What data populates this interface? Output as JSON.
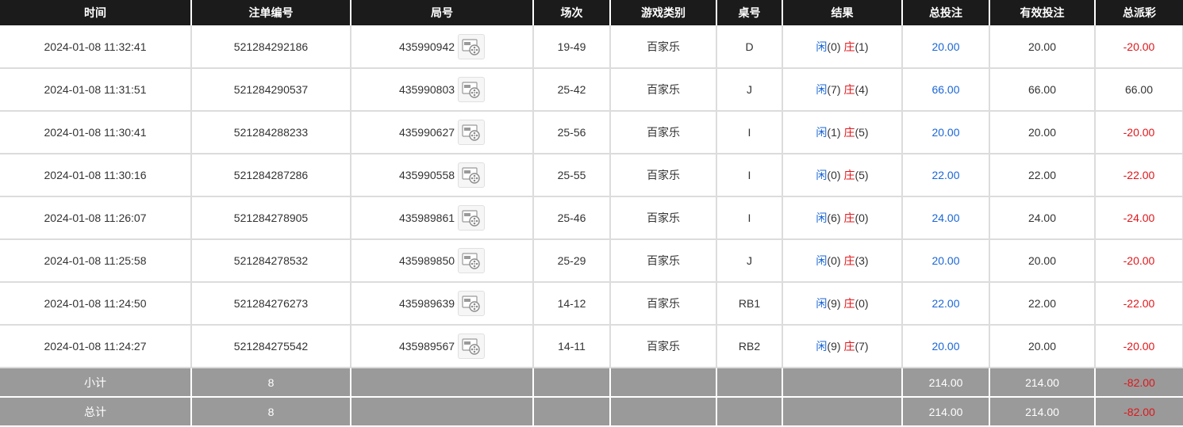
{
  "headers": [
    "时间",
    "注单编号",
    "局号",
    "场次",
    "游戏类别",
    "桌号",
    "结果",
    "总投注",
    "有效投注",
    "总派彩"
  ],
  "icons": {
    "replay": "video-replay-icon"
  },
  "rows": [
    {
      "time": "2024-01-08 11:32:41",
      "bet_id": "521284292186",
      "round": "435990942",
      "session": "19-49",
      "game": "百家乐",
      "table": "D",
      "player_label": "闲",
      "player_score": "(0)",
      "banker_label": "庄",
      "banker_score": "(1)",
      "total_bet": "20.00",
      "valid_bet": "20.00",
      "payout": "-20.00",
      "payout_negative": true
    },
    {
      "time": "2024-01-08 11:31:51",
      "bet_id": "521284290537",
      "round": "435990803",
      "session": "25-42",
      "game": "百家乐",
      "table": "J",
      "player_label": "闲",
      "player_score": "(7)",
      "banker_label": "庄",
      "banker_score": "(4)",
      "total_bet": "66.00",
      "valid_bet": "66.00",
      "payout": "66.00",
      "payout_negative": false
    },
    {
      "time": "2024-01-08 11:30:41",
      "bet_id": "521284288233",
      "round": "435990627",
      "session": "25-56",
      "game": "百家乐",
      "table": "I",
      "player_label": "闲",
      "player_score": "(1)",
      "banker_label": "庄",
      "banker_score": "(5)",
      "total_bet": "20.00",
      "valid_bet": "20.00",
      "payout": "-20.00",
      "payout_negative": true
    },
    {
      "time": "2024-01-08 11:30:16",
      "bet_id": "521284287286",
      "round": "435990558",
      "session": "25-55",
      "game": "百家乐",
      "table": "I",
      "player_label": "闲",
      "player_score": "(0)",
      "banker_label": "庄",
      "banker_score": "(5)",
      "total_bet": "22.00",
      "valid_bet": "22.00",
      "payout": "-22.00",
      "payout_negative": true
    },
    {
      "time": "2024-01-08 11:26:07",
      "bet_id": "521284278905",
      "round": "435989861",
      "session": "25-46",
      "game": "百家乐",
      "table": "I",
      "player_label": "闲",
      "player_score": "(6)",
      "banker_label": "庄",
      "banker_score": "(0)",
      "total_bet": "24.00",
      "valid_bet": "24.00",
      "payout": "-24.00",
      "payout_negative": true
    },
    {
      "time": "2024-01-08 11:25:58",
      "bet_id": "521284278532",
      "round": "435989850",
      "session": "25-29",
      "game": "百家乐",
      "table": "J",
      "player_label": "闲",
      "player_score": "(0)",
      "banker_label": "庄",
      "banker_score": "(3)",
      "total_bet": "20.00",
      "valid_bet": "20.00",
      "payout": "-20.00",
      "payout_negative": true
    },
    {
      "time": "2024-01-08 11:24:50",
      "bet_id": "521284276273",
      "round": "435989639",
      "session": "14-12",
      "game": "百家乐",
      "table": "RB1",
      "player_label": "闲",
      "player_score": "(9)",
      "banker_label": "庄",
      "banker_score": "(0)",
      "total_bet": "22.00",
      "valid_bet": "22.00",
      "payout": "-22.00",
      "payout_negative": true
    },
    {
      "time": "2024-01-08 11:24:27",
      "bet_id": "521284275542",
      "round": "435989567",
      "session": "14-11",
      "game": "百家乐",
      "table": "RB2",
      "player_label": "闲",
      "player_score": "(9)",
      "banker_label": "庄",
      "banker_score": "(7)",
      "total_bet": "20.00",
      "valid_bet": "20.00",
      "payout": "-20.00",
      "payout_negative": true
    }
  ],
  "subtotal": {
    "label": "小计",
    "count": "8",
    "total_bet": "214.00",
    "valid_bet": "214.00",
    "payout": "-82.00"
  },
  "grand_total": {
    "label": "总计",
    "count": "8",
    "total_bet": "214.00",
    "valid_bet": "214.00",
    "payout": "-82.00"
  },
  "colors": {
    "header_bg": "#1b1b1b",
    "totals_bg": "#9a9a9a",
    "blue": "#1a66d6",
    "red": "#e0161a"
  }
}
